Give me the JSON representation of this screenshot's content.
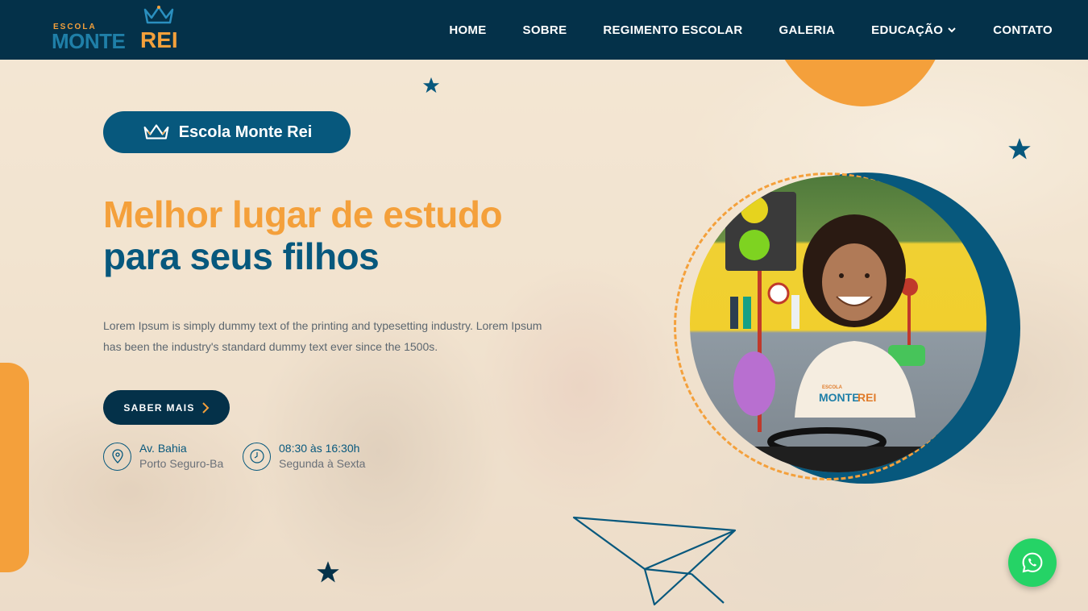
{
  "brand": {
    "logo_small": "ESCOLA",
    "logo_main": "MONTE",
    "logo_accent": "REI",
    "colors": {
      "navy": "#043149",
      "blue": "#07587d",
      "orange": "#f4a03b",
      "whatsapp": "#25d366"
    }
  },
  "nav": {
    "items": [
      {
        "label": "HOME"
      },
      {
        "label": "SOBRE"
      },
      {
        "label": "REGIMENTO ESCOLAR"
      },
      {
        "label": "GALERIA"
      },
      {
        "label": "EDUCAÇÃO",
        "icon": "chevron-down-icon"
      },
      {
        "label": "CONTATO"
      }
    ]
  },
  "hero": {
    "badge_label": "Escola Monte Rei",
    "headline_line1": "Melhor lugar de estudo",
    "headline_line2": "para seus filhos",
    "description": "Lorem Ipsum is simply dummy text of the printing and typesetting industry. Lorem Ipsum has been the industry's standard dummy text ever since the 1500s.",
    "cta_label": "SABER MAIS",
    "address": {
      "line1": "Av. Bahia",
      "line2": "Porto Seguro-Ba",
      "icon": "location-pin-icon"
    },
    "hours": {
      "line1": "08:30 às 16:30h",
      "line2": "Segunda à Sexta",
      "icon": "clock-icon"
    }
  },
  "photo": {
    "shirt_text_small": "ESCOLA",
    "shirt_text_main": "MONTE",
    "shirt_text_accent": "REI"
  },
  "widgets": {
    "whatsapp_icon": "whatsapp-icon"
  }
}
